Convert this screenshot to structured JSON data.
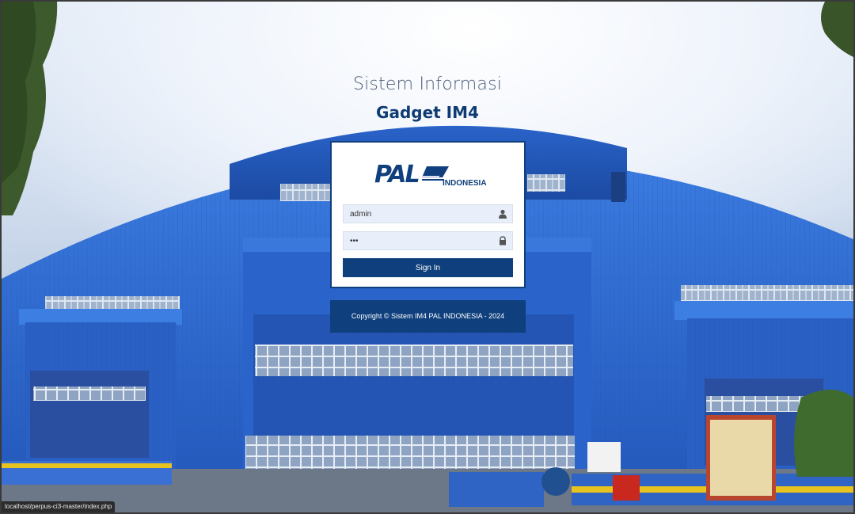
{
  "header": {
    "subtitle": "Sistem Informasi",
    "title": "Gadget IM4"
  },
  "logo": {
    "text": "PAL",
    "sub": "INDONESIA"
  },
  "login": {
    "username_value": "admin",
    "password_value": "•••",
    "signin_label": "Sign In"
  },
  "footer": {
    "copyright": "Copyright © Sistem IM4 PAL INDONESIA - 2024"
  },
  "status_bar": {
    "url": "localhost/perpus-ci3-master/index.php"
  },
  "colors": {
    "brand_navy": "#0f3f7c",
    "hangar_blue": "#2f6bd0"
  }
}
